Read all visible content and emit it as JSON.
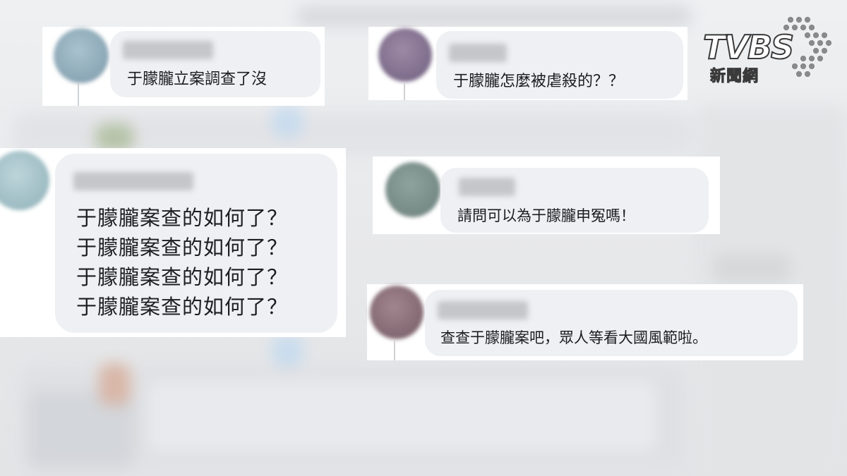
{
  "comments": [
    {
      "text": "于朦朧立案調查了沒"
    },
    {
      "text": "于朦朧怎麼被虐殺的？？"
    },
    {
      "lines": [
        "于朦朧案查的如何了？",
        "于朦朧案查的如何了？",
        "于朦朧案查的如何了？",
        "于朦朧案查的如何了？"
      ]
    },
    {
      "text": "請問可以為于朦朧申冤嗎！"
    },
    {
      "text": "查查于朦朧案吧，眾人等看大國風範啦。"
    }
  ],
  "logo": {
    "word": "TVBS",
    "sub": "新聞網"
  },
  "colors": {
    "bubble": "#eef0f3",
    "card": "#ffffff",
    "logo_dots": "#8a8a8a"
  }
}
